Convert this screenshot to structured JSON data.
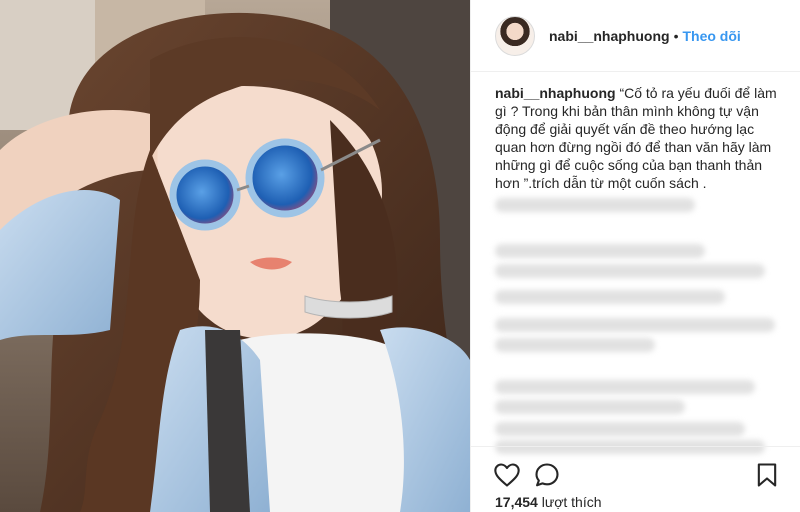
{
  "post": {
    "username": "nabi__nhaphuong",
    "separator": "•",
    "follow_label": "Theo dõi"
  },
  "caption": {
    "username": "nabi__nhaphuong",
    "text": "“Cố tỏ ra yếu đuối để làm gì ? Trong khi bản thân mình không tự vận động để giải quyết vấn đề theo hướng lạc quan hơn đừng ngồi đó để than văn hãy làm những gì để cuộc sống của bạn thanh thản hơn ”.trích dẫn từ một cuốn sách ."
  },
  "stats": {
    "likes_count": "17,454",
    "likes_label": "lượt thích"
  },
  "icons": {
    "like": "heart-icon",
    "comment": "comment-icon",
    "save": "bookmark-icon"
  },
  "colors": {
    "link": "#3897f0",
    "text": "#262626",
    "border": "#efefef"
  }
}
